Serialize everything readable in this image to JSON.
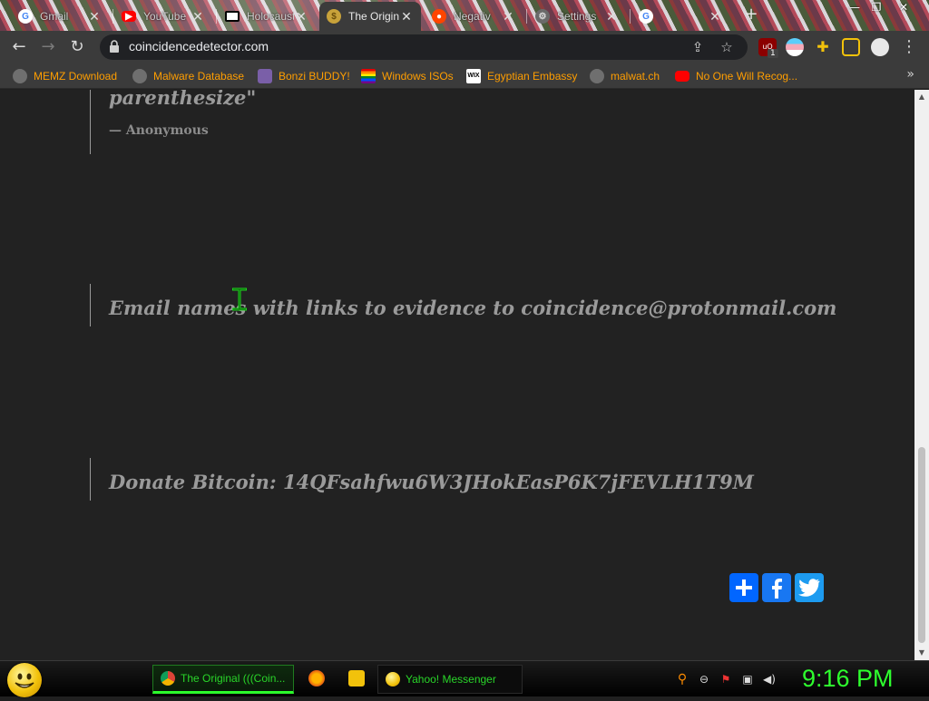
{
  "browser": {
    "tabs": [
      {
        "title": "Gmail",
        "icon": "google-icon"
      },
      {
        "title": "YouTube",
        "icon": "youtube-icon"
      },
      {
        "title": "Holocaust",
        "icon": "flag-icon"
      },
      {
        "title": "The Original",
        "icon": "coin-icon",
        "active": true
      },
      {
        "title": "Negativ",
        "icon": "reddit-icon"
      },
      {
        "title": "Settings",
        "icon": "gear-icon"
      },
      {
        "title": "",
        "icon": "google-icon"
      }
    ],
    "url": "coincidencedetector.com",
    "extension_badge": "1",
    "bookmarks": [
      {
        "label": "MEMZ Download",
        "icon": "globe-icon"
      },
      {
        "label": "Malware Database",
        "icon": "globe-icon"
      },
      {
        "label": "Bonzi BUDDY!",
        "icon": "bonzi-icon"
      },
      {
        "label": "Windows ISOs",
        "icon": "rainbow-flag-icon"
      },
      {
        "label": "Egyptian Embassy",
        "icon": "wix-icon"
      },
      {
        "label": "malwat.ch",
        "icon": "globe-icon"
      },
      {
        "label": "No One Will Recog...",
        "icon": "youtube-icon"
      }
    ],
    "bookmarks_overflow": "»"
  },
  "page": {
    "quote1_text": "parenthesize\"",
    "quote1_attribution": "— Anonymous",
    "email_text": "Email names with links to evidence to coincidence@protonmail.com",
    "donate_text": "Donate Bitcoin: 14QFsahfwu6W3JHokEasP6K7jFEVLH1T9M",
    "share_buttons": [
      "share-plus-icon",
      "facebook-icon",
      "twitter-icon"
    ]
  },
  "taskbar": {
    "tasks": [
      {
        "label": "The Original (((Coin...",
        "icon": "chrome-icon"
      },
      {
        "label": "Yahoo! Messenger",
        "icon": "yahoo-messenger-icon"
      }
    ],
    "clock": "9:16 PM"
  },
  "colors": {
    "page_bg": "#222222",
    "quote_text": "#9a9a9a",
    "bookmark_text": "#ff9e00",
    "taskbar_green": "#2eff2e",
    "share_blue": "#1a73e8"
  }
}
